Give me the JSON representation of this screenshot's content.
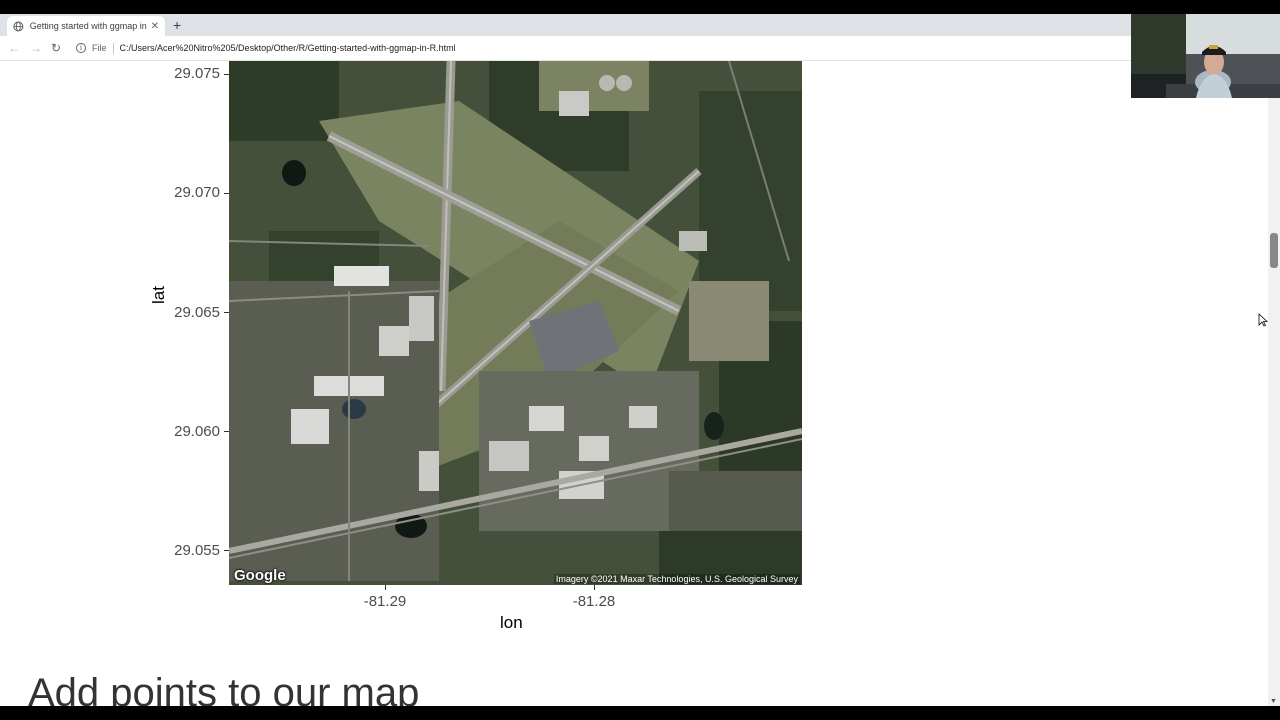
{
  "browser": {
    "tab_title": "Getting started with ggmap in R",
    "tab_close": "✕",
    "new_tab": "+",
    "back": "←",
    "forward": "→",
    "reload": "↻",
    "info_glyph": "i",
    "file_label": "File",
    "url": "C:/Users/Acer%20Nitro%205/Desktop/Other/R/Getting-started-with-ggmap-in-R.html"
  },
  "plot": {
    "y_axis_title": "lat",
    "x_axis_title": "lon",
    "y_ticks": [
      "29.075",
      "29.070",
      "29.065",
      "29.060",
      "29.055"
    ],
    "x_ticks": [
      "-81.29",
      "-81.28"
    ],
    "map_logo": "Google",
    "map_attribution": "Imagery ©2021 Maxar Technologies, U.S. Geological Survey"
  },
  "chart_data": {
    "type": "map",
    "title": "",
    "xlabel": "lon",
    "ylabel": "lat",
    "x_ticks": [
      -81.29,
      -81.28
    ],
    "y_ticks": [
      29.055,
      29.06,
      29.065,
      29.07,
      29.075
    ],
    "legend": "none"
  },
  "content": {
    "section_heading": "Add points to our map"
  },
  "icons": {
    "tab_favicon": "globe-icon",
    "info": "info-icon",
    "cursor": "mouse-cursor-icon"
  },
  "colors": {
    "tab_bar": "#dee1e6",
    "page_bg": "#ffffff",
    "heading_text": "#333333",
    "axis_text": "#4d4d4d"
  }
}
